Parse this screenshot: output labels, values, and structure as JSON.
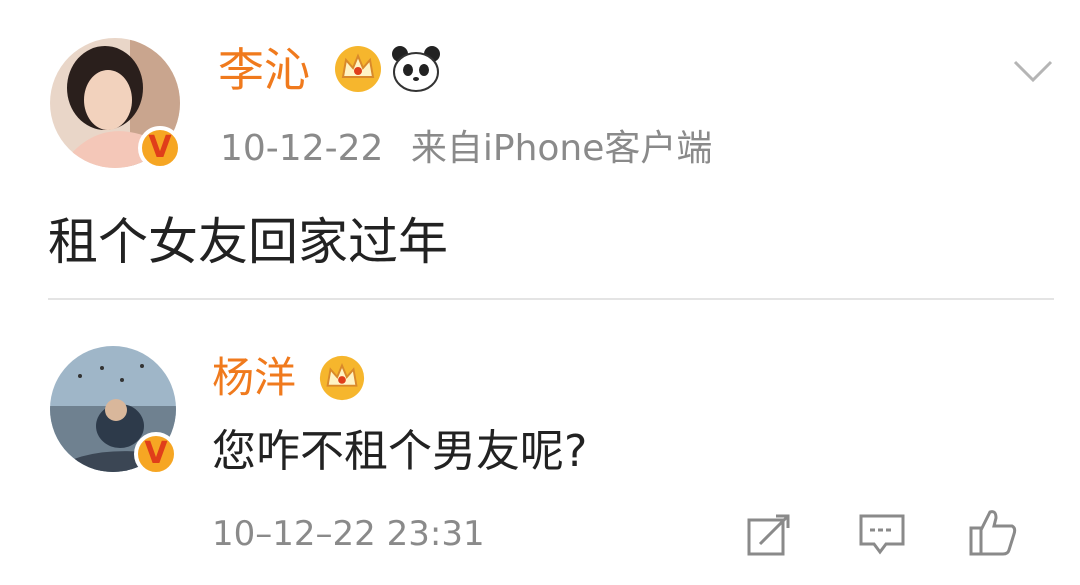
{
  "post": {
    "author": {
      "name": "李沁",
      "verified_mark": "V",
      "badges": [
        "crown-icon",
        "panda-icon"
      ]
    },
    "timestamp": "10-12-22",
    "source": "来自iPhone客户端",
    "content": "租个女友回家过年",
    "menu_icon": "chevron-down-icon"
  },
  "comment": {
    "author": {
      "name": "杨洋",
      "verified_mark": "V",
      "badges": [
        "crown-icon"
      ]
    },
    "content": "您咋不租个男友呢?",
    "timestamp": "10–12–22 23:31",
    "actions": [
      "share-icon",
      "comment-icon",
      "like-icon"
    ]
  },
  "colors": {
    "name": "#f07a1d",
    "meta": "#8a8a8a",
    "text": "#222222",
    "badge": "#f6a623",
    "verified_v": "#e03e1a"
  }
}
